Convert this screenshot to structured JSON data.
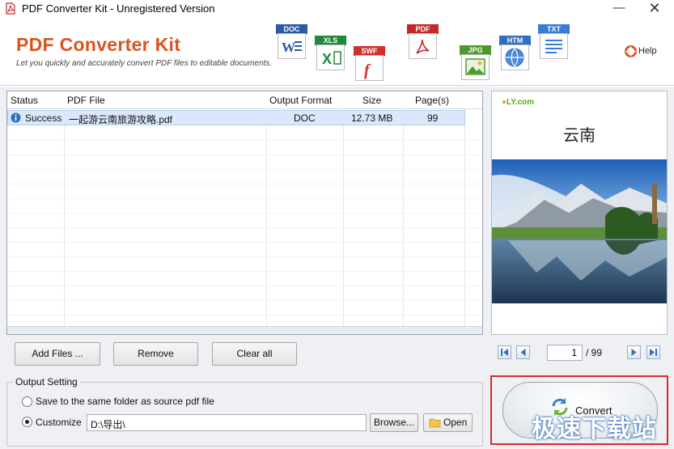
{
  "window": {
    "title": "PDF Converter Kit - Unregistered Version",
    "minimize": "—",
    "close": "✕"
  },
  "header": {
    "brand": "PDF Converter Kit",
    "tagline": "Let you quickly and accurately convert PDF files to editable documents.",
    "help_label": "Help",
    "formats": [
      {
        "label": "DOC",
        "color": "#2d5aa8"
      },
      {
        "label": "XLS",
        "color": "#1f8a3b"
      },
      {
        "label": "SWF",
        "color": "#d32f2f"
      },
      {
        "label": "PDF",
        "color": "#c62828"
      },
      {
        "label": "JPG",
        "color": "#4c9a2a"
      },
      {
        "label": "HTM",
        "color": "#2f6fc0"
      },
      {
        "label": "TXT",
        "color": "#3a7bd5"
      }
    ]
  },
  "file_table": {
    "columns": [
      "Status",
      "PDF File",
      "Output Format",
      "Size",
      "Page(s)"
    ],
    "rows": [
      {
        "status": "Success",
        "file": "一起游云南旅游攻略.pdf",
        "format": "DOC",
        "size": "12.73 MB",
        "pages": "99"
      }
    ]
  },
  "actions": {
    "add_files": "Add Files ...",
    "remove": "Remove",
    "clear_all": "Clear all"
  },
  "output_setting": {
    "title": "Output Setting",
    "option_same_folder": "Save to the same folder as source pdf file",
    "option_customize": "Customize",
    "path": "D:\\导出\\",
    "browse": "Browse...",
    "open": "Open"
  },
  "preview": {
    "logo": "LY.com",
    "doc_title": "云南"
  },
  "pager": {
    "current": "1",
    "total": "/ 99"
  },
  "convert": {
    "label": "Convert"
  },
  "watermark": "极速下载站"
}
